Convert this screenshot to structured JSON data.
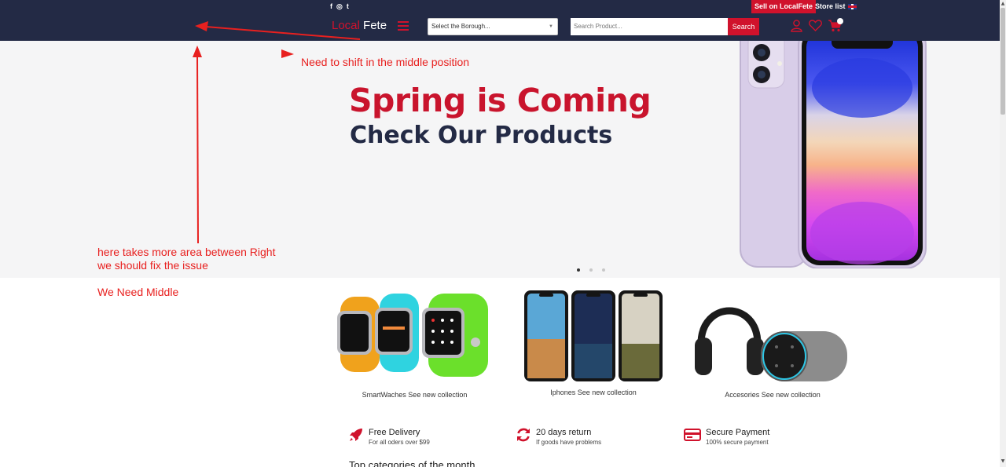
{
  "topbar": {
    "social": {
      "facebook": "f",
      "instagram": "◎",
      "twitter": "t"
    },
    "sell_label": "Sell on LocalFete",
    "store_list_label": "Store list"
  },
  "nav": {
    "logo_part1": "Local",
    "logo_part2": "Fete",
    "borough_placeholder": "Select the Borough...",
    "search_placeholder": "Search Product...",
    "search_button": "Search"
  },
  "hero": {
    "title": "Spring is Coming",
    "subtitle": "Check Our Products",
    "active_slide": 1,
    "slide_count": 3
  },
  "annotations": {
    "shift_note": "Need to shift in the middle position",
    "area_note_1": "here takes more area between Right",
    "area_note_2": "we should fix the issue",
    "middle_note": "We Need Middle"
  },
  "categories": [
    {
      "label": "SmartWaches See new collection"
    },
    {
      "label": "Iphones See new collection"
    },
    {
      "label": "Accesories See new collection"
    }
  ],
  "features": [
    {
      "title": "Free Delivery",
      "subtitle": "For all oders over $99",
      "icon": "rocket-icon"
    },
    {
      "title": "20 days return",
      "subtitle": "If goods have problems",
      "icon": "refresh-icon"
    },
    {
      "title": "Secure Payment",
      "subtitle": "100% secure payment",
      "icon": "credit-card-icon"
    }
  ],
  "section_heading": "Top categories of the month",
  "colors": {
    "brand_dark": "#232a45",
    "brand_red": "#d0122c",
    "annotation_red": "#e8201f"
  }
}
